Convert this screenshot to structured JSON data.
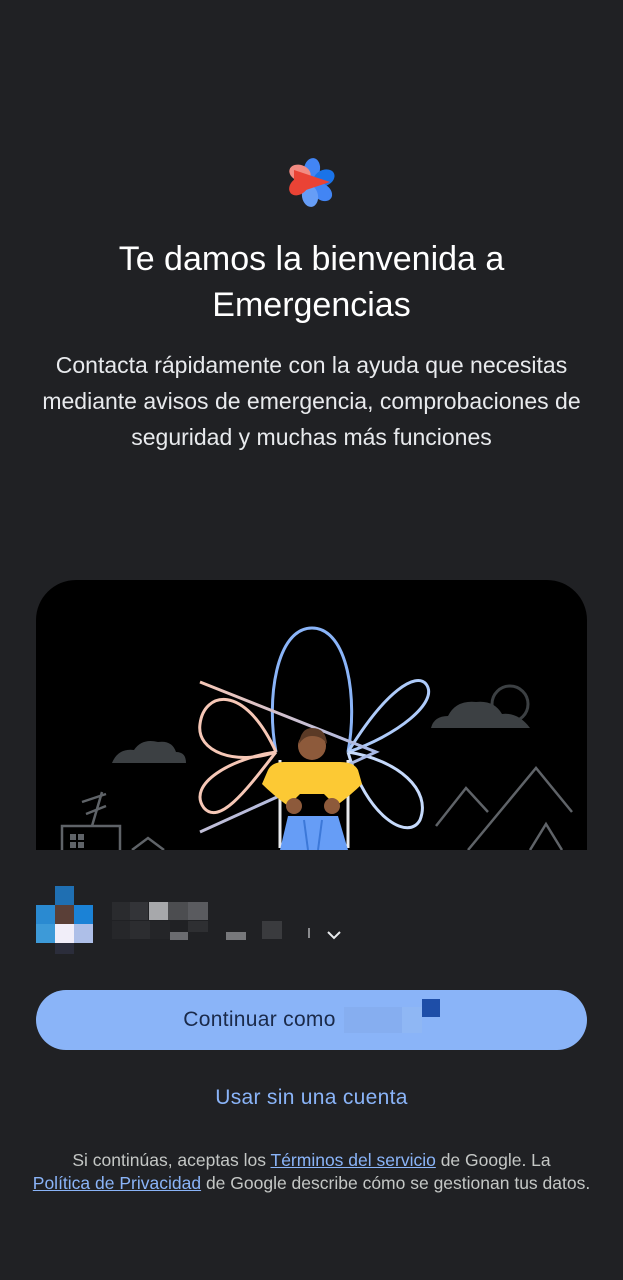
{
  "app": {
    "logo_icon": "emergency-heart-play-icon",
    "brand_colors": [
      "#ea4335",
      "#4285f4",
      "#1a73e8"
    ]
  },
  "welcome": {
    "title": "Te damos la bienvenida a Emergencias",
    "subtitle": "Contacta rápidamente con la ayuda que necesitas mediante avisos de emergencia, comprobaciones de seguridad y muchas más funciones"
  },
  "illustration": {
    "icon": "person-with-heart-illustration"
  },
  "account": {
    "avatar_icon": "account-avatar-icon",
    "name": "",
    "chevron_icon": "chevron-down-icon"
  },
  "actions": {
    "continue_label": "Continuar como",
    "no_account_label": "Usar sin una cuenta"
  },
  "legal": {
    "part1": "Si continúas, aceptas los ",
    "terms_link": "Términos del servicio",
    "part2": " de Google. La ",
    "privacy_link": "Política de Privacidad",
    "part3": " de Google describe cómo se gestionan tus datos."
  },
  "colors": {
    "background": "#202124",
    "accent": "#8ab4f8",
    "button_text": "#1a2a4a"
  }
}
